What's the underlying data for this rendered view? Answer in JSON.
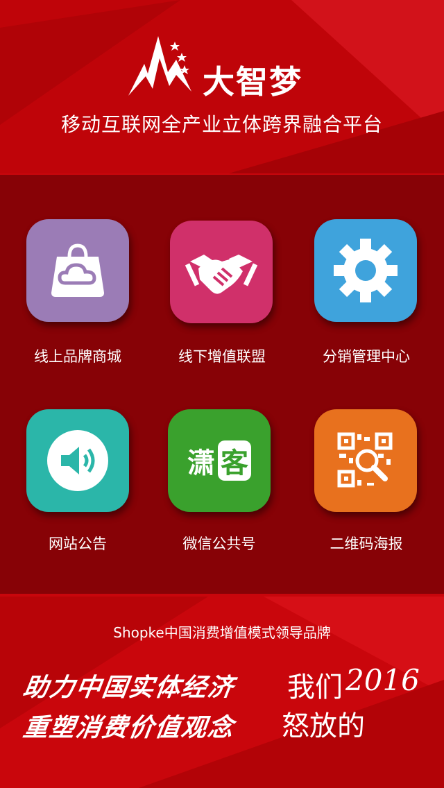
{
  "header": {
    "brand_name": "大智梦",
    "tagline": "移动互联网全产业立体跨界融合平台"
  },
  "menu": [
    {
      "label": "线上品牌商城",
      "icon": "shopping-bag-icon",
      "color": "#9b7cb6"
    },
    {
      "label": "线下增值联盟",
      "icon": "handshake-icon",
      "color": "#d0306a"
    },
    {
      "label": "分销管理中心",
      "icon": "gear-icon",
      "color": "#3fa3dc"
    },
    {
      "label": "网站公告",
      "icon": "speaker-icon",
      "color": "#2bb6a9"
    },
    {
      "label": "微信公共号",
      "icon": "wechat-account-icon",
      "color": "#3aa12d",
      "badge_left": "潇",
      "badge_right": "客"
    },
    {
      "label": "二维码海报",
      "icon": "qr-code-icon",
      "color": "#e8711e"
    }
  ],
  "footer": {
    "subtitle": "Shopke中国消费增值模式领导品牌",
    "slogan_line1": "助力中国实体经济",
    "slogan_line2": "重塑消费价值观念",
    "hand_line1": "我们",
    "hand_year": "2016",
    "hand_line2": "怒放的"
  },
  "colors": {
    "background": "#c4040a",
    "panel": "#6a0005"
  }
}
